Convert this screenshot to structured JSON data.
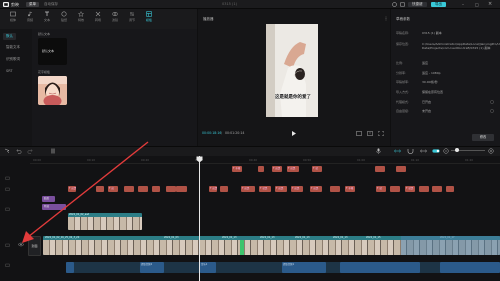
{
  "titlebar": {
    "app_name": "剪映",
    "menu_label": "菜单",
    "save_status": "自动保存",
    "project_title": "0315 (1)",
    "shortcut_label": "快捷键",
    "export_label": "导出"
  },
  "tools": [
    {
      "label": "媒体",
      "icon": "media-icon",
      "active": false
    },
    {
      "label": "音频",
      "icon": "audio-icon",
      "active": false
    },
    {
      "label": "文本",
      "icon": "text-icon",
      "active": false
    },
    {
      "label": "贴纸",
      "icon": "sticker-icon",
      "active": false
    },
    {
      "label": "特效",
      "icon": "effect-icon",
      "active": false
    },
    {
      "label": "转场",
      "icon": "transition-icon",
      "active": false
    },
    {
      "label": "滤镜",
      "icon": "filter-icon",
      "active": false
    },
    {
      "label": "调节",
      "icon": "adjust-icon",
      "active": false
    },
    {
      "label": "模板",
      "icon": "template-icon",
      "active": true
    }
  ],
  "media": {
    "side_items": [
      "默认",
      "智能文本",
      "识别歌词",
      "SRT"
    ],
    "section1_label": "默认文本",
    "thumb1_text": "默认文本",
    "section2_label": "花字模板"
  },
  "player": {
    "header": "播放器",
    "caption": "这是就是你的爱了",
    "time_current": "00:00:18:16",
    "time_total": "00:01:20:14"
  },
  "detail": {
    "header": "草稿参数",
    "rows": [
      {
        "key": "草稿名称:",
        "val": "0315 (1) 副本"
      },
      {
        "key": "保存位置:",
        "val": "C:/Users/Administrator/AppData/Local/JianyingPro/User Data/Projects/com.lveditor.draft/0315 (1) 副本"
      },
      {
        "key": "比例:",
        "val": "适应"
      },
      {
        "key": "分辨率:",
        "val": "适应 - 1080p"
      },
      {
        "key": "草稿帧率:",
        "val": "30.00帧/秒"
      },
      {
        "key": "导入方式:",
        "val": "保留在原有位置"
      },
      {
        "key": "代理模式:",
        "val": "已开启"
      },
      {
        "key": "自由层级:",
        "val": "未开启"
      }
    ],
    "modify_label": "修改"
  },
  "timeline": {
    "ticks": [
      "00:00",
      "00:10",
      "00:20",
      "00:30",
      "00:40",
      "00:50",
      "01:00",
      "01:10",
      "01:20"
    ],
    "cover_label": "封面",
    "red_clips": [
      "T 字幕",
      "T 这是",
      "T 这是",
      "T 就",
      "T 这是",
      "T 这",
      "T 这是",
      "T 这是",
      "T 就是",
      "T 这是",
      "T 这是",
      "T 这是",
      "T 字幕",
      "T 就",
      "T 就是"
    ],
    "purple_clips": [
      "贴纸",
      "特效"
    ],
    "video_clip_labels": [
      "2022_01_02_aad",
      "2022_01_02_16_25_02_3_20",
      "2022_01_03",
      "2022_01_13",
      "2022_01_13",
      "2022_01_13",
      "2022_01_13",
      "2022_01_15",
      "2022_01_17"
    ],
    "audio_labels": [
      "提取音频2",
      "音乐1",
      "提取音频1"
    ]
  },
  "colors": {
    "accent": "#39c9d8",
    "arrow": "#e23b3b"
  }
}
